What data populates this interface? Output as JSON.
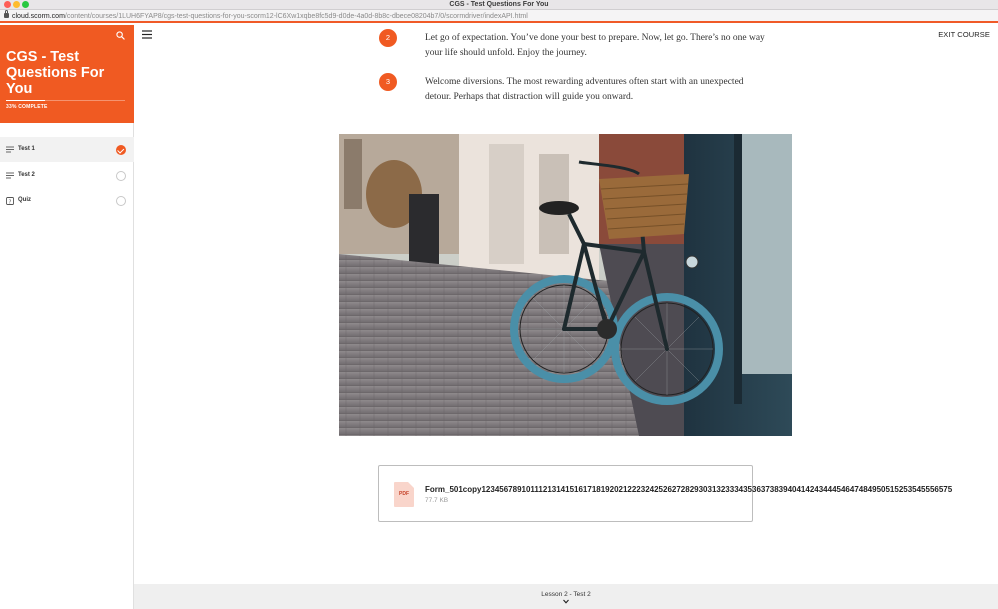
{
  "window": {
    "title": "CGS - Test Questions For You"
  },
  "browser": {
    "url_host": "cloud.scorm.com",
    "url_path": "/content/courses/1LUH6FYAP8/cgs-test-questions-for-you-scorm12-lC6Xw1xqbe8fc5d9-d0de-4a0d-8b8c-dbece08204b7/0/scormdriver/indexAPI.html"
  },
  "sidebar": {
    "course_title": "CGS - Test Questions For You",
    "progress_label": "33% COMPLETE",
    "progress_fraction": 0.33,
    "search_icon": "search-icon",
    "lessons": [
      {
        "label": "Test 1",
        "icon": "lines-icon",
        "status": "complete",
        "active": true
      },
      {
        "label": "Test 2",
        "icon": "lines-icon",
        "status": "incomplete",
        "active": false
      },
      {
        "label": "Quiz",
        "icon": "quiz-icon",
        "status": "incomplete",
        "active": false
      }
    ]
  },
  "main": {
    "menu_icon": "hamburger-icon",
    "exit_label": "EXIT COURSE",
    "steps": [
      {
        "number": "2",
        "text": "Let go of expectation. You’ve done your best to prepare. Now, let go. There’s no one way your life should unfold. Enjoy the journey."
      },
      {
        "number": "3",
        "text": "Welcome diversions. The most rewarding adventures often start with an unexpected detour. Perhaps that distraction will guide you onward."
      }
    ],
    "attachment": {
      "icon_label": "PDF",
      "file_name": "Form_501copy1234567891011121314151617181920212223242526272829303132333435363738394041424344454647484950515253545556575",
      "file_size": "77.7 KB"
    }
  },
  "footer": {
    "next_lesson_label": "Lesson 2 - Test 2"
  },
  "colors": {
    "accent": "#f05a22",
    "footer_bg": "#efefef"
  }
}
